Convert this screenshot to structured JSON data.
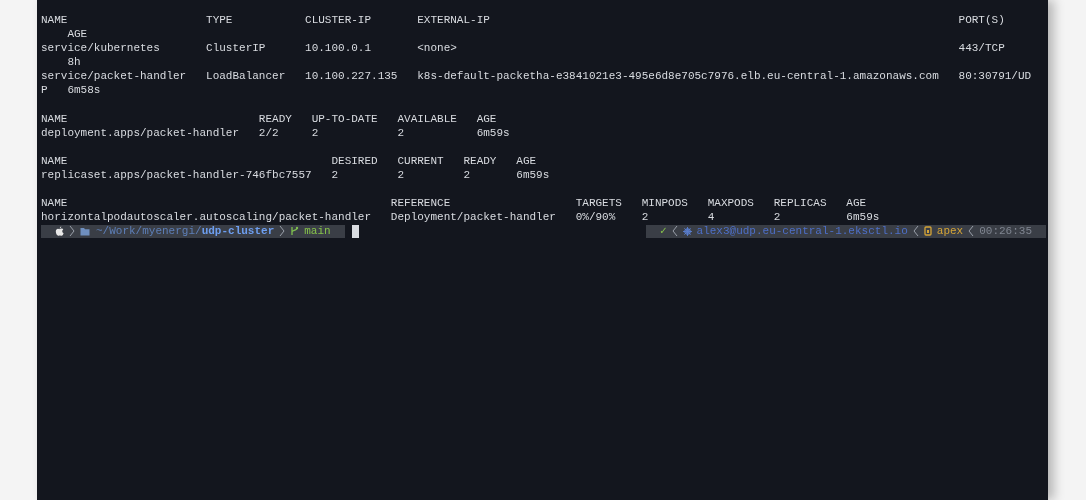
{
  "terminal": {
    "tables": [
      {
        "columns": [
          "NAME",
          "TYPE",
          "CLUSTER-IP",
          "EXTERNAL-IP",
          "PORT(S)",
          "AGE"
        ],
        "rows": [
          [
            "service/kubernetes",
            "ClusterIP",
            "10.100.0.1",
            "<none>",
            "443/TCP",
            "8h"
          ],
          [
            "service/packet-handler",
            "LoadBalancer",
            "10.100.227.135",
            "k8s-default-packetha-e3841021e3-495e6d8e705c7976.elb.eu-central-1.amazonaws.com",
            "80:30791/UDP",
            "6m58s"
          ]
        ]
      },
      {
        "columns": [
          "NAME",
          "READY",
          "UP-TO-DATE",
          "AVAILABLE",
          "AGE"
        ],
        "rows": [
          [
            "deployment.apps/packet-handler",
            "2/2",
            "2",
            "2",
            "6m59s"
          ]
        ]
      },
      {
        "columns": [
          "NAME",
          "DESIRED",
          "CURRENT",
          "READY",
          "AGE"
        ],
        "rows": [
          [
            "replicaset.apps/packet-handler-746fbc7557",
            "2",
            "2",
            "2",
            "6m59s"
          ]
        ]
      },
      {
        "columns": [
          "NAME",
          "REFERENCE",
          "TARGETS",
          "MINPODS",
          "MAXPODS",
          "REPLICAS",
          "AGE"
        ],
        "rows": [
          [
            "horizontalpodautoscaler.autoscaling/packet-handler",
            "Deployment/packet-handler",
            "0%/90%",
            "2",
            "4",
            "2",
            "6m59s"
          ]
        ]
      }
    ],
    "prompt": {
      "path_prefix": "~/Work/myenergi/",
      "path_current": "udp-cluster",
      "branch": "main",
      "status": "✓",
      "context": "alex3@udp.eu-central-1.eksctl.io",
      "namespace": "apex",
      "time": "00:26:35"
    }
  }
}
